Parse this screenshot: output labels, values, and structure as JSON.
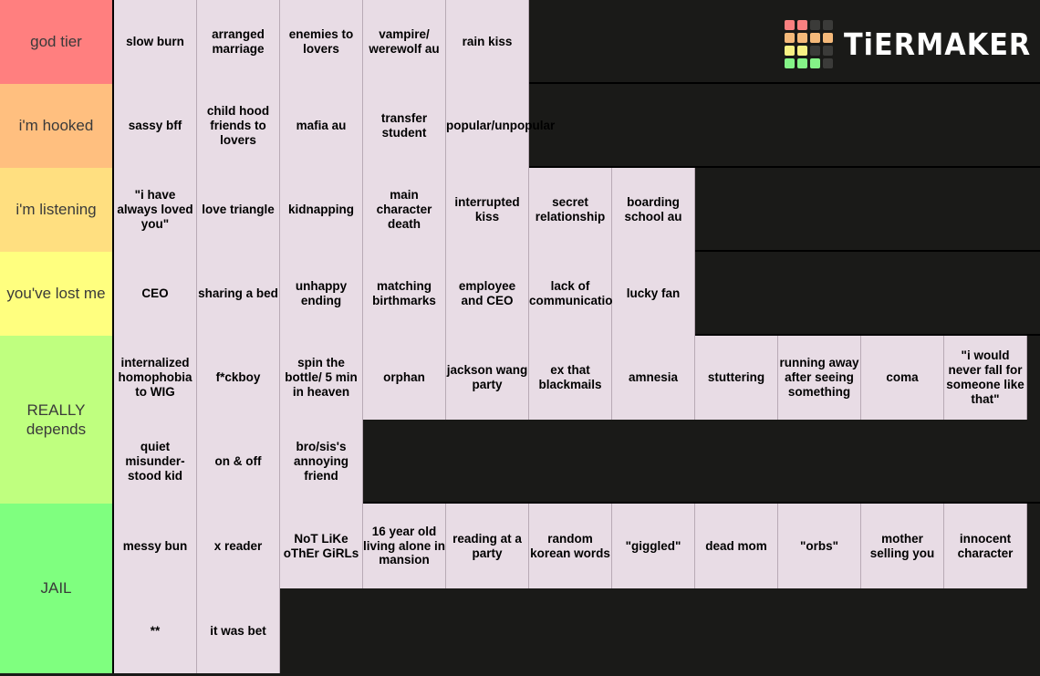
{
  "app": {
    "logo_text": "TiERMAKER",
    "logo_icon": "tiermaker-grid-logo"
  },
  "logo_grid_colors": [
    "#f98080",
    "#f98080",
    "#3b3b39",
    "#3b3b39",
    "#f5b97a",
    "#f5b97a",
    "#f5b97a",
    "#f5b97a",
    "#f7f184",
    "#f7f184",
    "#3b3b39",
    "#3b3b39",
    "#84f387",
    "#84f387",
    "#84f387",
    "#3b3b39"
  ],
  "colors": {
    "background": "#1a1a18",
    "tile_background": "#e8dce5",
    "tile_border": "#b8aab5",
    "row_border": "#000000",
    "label_text": "#3a3a3a",
    "tile_text": "#000000"
  },
  "tiers": [
    {
      "label": "god tier",
      "color": "#ff7f7f",
      "items": [
        "slow burn",
        "arranged marriage",
        "enemies to lovers",
        "vampire/ werewolf au",
        "rain kiss"
      ]
    },
    {
      "label": "i'm hooked",
      "color": "#ffbf7f",
      "items": [
        "sassy bff",
        "child hood friends to lovers",
        "mafia au",
        "transfer student",
        "popular/unpopular"
      ]
    },
    {
      "label": "i'm listening",
      "color": "#ffdf80",
      "items": [
        "\"i have always loved you\"",
        "love triangle",
        "kidnapping",
        "main character death",
        "interrupted kiss",
        "secret relationship",
        "boarding school au"
      ]
    },
    {
      "label": "you've lost me",
      "color": "#ffff7f",
      "items": [
        "CEO",
        "sharing a bed",
        "unhappy ending",
        "matching birthmarks",
        "employee and CEO",
        "lack of communication",
        "lucky fan"
      ]
    },
    {
      "label": "REALLY depends",
      "color": "#bfff7f",
      "items": [
        "internalized homophobia to WIG",
        "f*ckboy",
        "spin the bottle/ 5 min in heaven",
        "orphan",
        "jackson wang party",
        "ex that blackmails",
        "amnesia",
        "stuttering",
        "running away after seeing something",
        "coma",
        "\"i would never fall for someone like that\"",
        "quiet misunder- stood kid",
        "on & off",
        "bro/sis's annoying friend"
      ]
    },
    {
      "label": "JAIL",
      "color": "#7fff7f",
      "items": [
        "messy bun",
        "x reader",
        "NoT LiKe oThEr GiRLs",
        "16 year old living alone in mansion",
        "reading at a party",
        "random korean words",
        "\"giggled\"",
        "dead mom",
        "\"orbs\"",
        "mother selling you",
        "innocent character",
        "**",
        "it was bet"
      ]
    }
  ]
}
